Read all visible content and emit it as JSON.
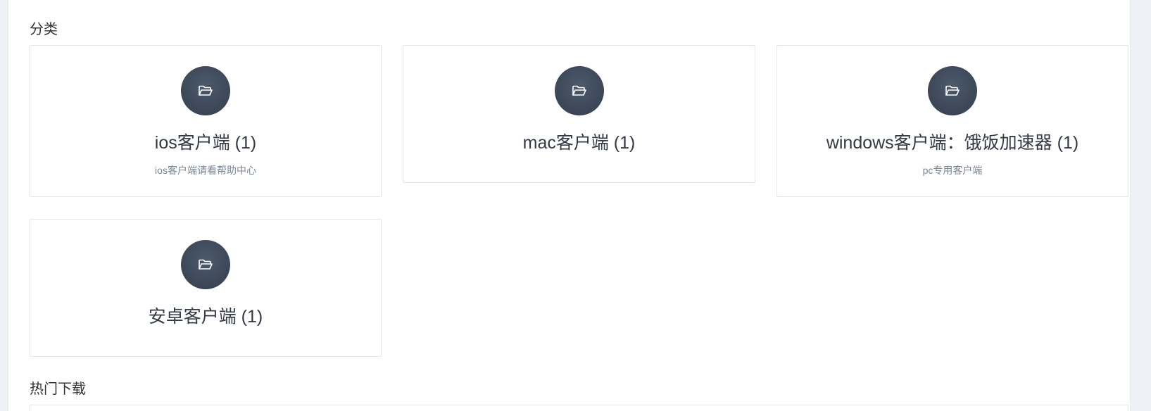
{
  "sections": {
    "category_title": "分类",
    "hot_downloads_title": "热门下载"
  },
  "categories": [
    {
      "title": "ios客户端 (1)",
      "description": "ios客户端请看帮助中心",
      "icon": "folder-open-icon"
    },
    {
      "title": "mac客户端 (1)",
      "description": "",
      "icon": "folder-open-icon"
    },
    {
      "title": "windows客户端：饿饭加速器 (1)",
      "description": "pc专用客户端",
      "icon": "folder-open-icon"
    },
    {
      "title": "安卓客户端 (1)",
      "description": "",
      "icon": "folder-open-icon"
    }
  ],
  "colors": {
    "icon_circle": "#3b4656",
    "card_border": "#e4e6ea",
    "side_background": "#eef1f5"
  }
}
